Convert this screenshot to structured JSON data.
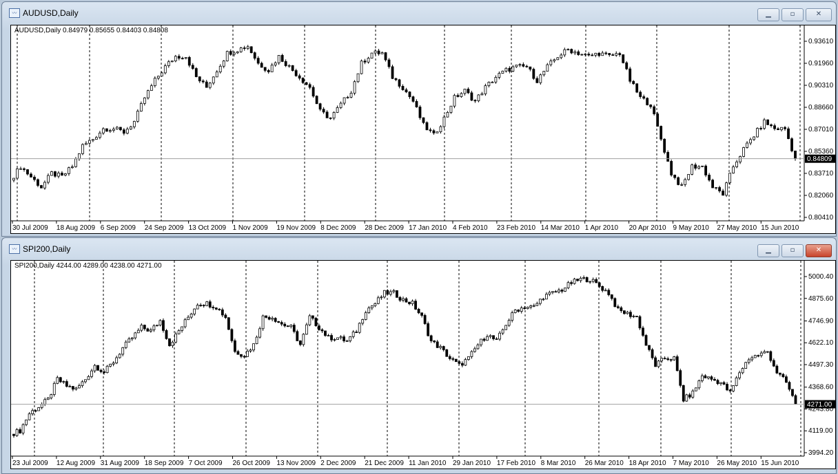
{
  "windows": [
    {
      "title": "AUDUSD,Daily",
      "info": "AUDUSD,Daily  0.84979 0.85655 0.84403 0.84808",
      "buttons": {
        "minimize": "minimize-icon",
        "maximize": "maximize-icon",
        "close": "close-icon"
      }
    },
    {
      "title": "SPI200,Daily",
      "info": "SPI200,Daily  4244.00 4289.00 4238.00 4271.00",
      "buttons": {
        "minimize": "minimize-icon",
        "maximize": "maximize-icon",
        "close": "close-icon"
      }
    }
  ],
  "chart_data": [
    {
      "type": "candlestick",
      "symbol": "AUDUSD",
      "timeframe": "Daily",
      "last_ohlc": {
        "open": 0.84979,
        "high": 0.85655,
        "low": 0.84403,
        "close": 0.84809
      },
      "current_price_label": "0.84809",
      "ylim": [
        0.8041,
        0.9361
      ],
      "y_ticks": [
        "0.93610",
        "0.91960",
        "0.90310",
        "0.88660",
        "0.87010",
        "0.85360",
        "0.83710",
        "0.82060",
        "0.80410"
      ],
      "x_ticks": [
        "30 Jul 2009",
        "18 Aug 2009",
        "6 Sep 2009",
        "24 Sep 2009",
        "13 Oct 2009",
        "1 Nov 2009",
        "19 Nov 2009",
        "8 Dec 2009",
        "28 Dec 2009",
        "17 Jan 2010",
        "4 Feb 2010",
        "23 Feb 2010",
        "14 Mar 2010",
        "1 Apr 2010",
        "20 Apr 2010",
        "9 May 2010",
        "27 May 2010",
        "15 Jun 2010"
      ],
      "closes_approx": [
        0.832,
        0.8423,
        0.8345,
        0.8268,
        0.8371,
        0.8345,
        0.8423,
        0.8577,
        0.8629,
        0.8706,
        0.8706,
        0.868,
        0.8758,
        0.8938,
        0.9067,
        0.917,
        0.9248,
        0.9248,
        0.9093,
        0.9016,
        0.9144,
        0.9273,
        0.9299,
        0.9325,
        0.9196,
        0.9144,
        0.9248,
        0.917,
        0.9093,
        0.9016,
        0.8835,
        0.8784,
        0.8887,
        0.899,
        0.9196,
        0.9273,
        0.9273,
        0.9093,
        0.9016,
        0.8912,
        0.8732,
        0.8655,
        0.8784,
        0.8938,
        0.899,
        0.8912,
        0.9016,
        0.9093,
        0.9144,
        0.917,
        0.917,
        0.9067,
        0.917,
        0.9248,
        0.9299,
        0.9273,
        0.9248,
        0.9273,
        0.9248,
        0.9273,
        0.9067,
        0.8938,
        0.8887,
        0.8629,
        0.8371,
        0.8268,
        0.8423,
        0.8423,
        0.8268,
        0.8216,
        0.8423,
        0.8552,
        0.8655,
        0.8758,
        0.8706,
        0.8706,
        0.8481
      ]
    },
    {
      "type": "candlestick",
      "symbol": "SPI200",
      "timeframe": "Daily",
      "last_ohlc": {
        "open": 4244.0,
        "high": 4289.0,
        "low": 4238.0,
        "close": 4271.0
      },
      "current_price_label": "4271.00",
      "ylim": [
        3994.2,
        5000.4
      ],
      "y_ticks": [
        "5000.40",
        "4875.60",
        "4746.90",
        "4622.10",
        "4497.30",
        "4368.60",
        "4243.80",
        "4119.00",
        "3994.20"
      ],
      "x_ticks": [
        "23 Jul 2009",
        "12 Aug 2009",
        "31 Aug 2009",
        "18 Sep 2009",
        "7 Oct 2009",
        "26 Oct 2009",
        "13 Nov 2009",
        "2 Dec 2009",
        "21 Dec 2009",
        "11 Jan 2010",
        "29 Jan 2010",
        "17 Feb 2010",
        "8 Mar 2010",
        "26 Mar 2010",
        "18 Apr 2010",
        "7 May 2010",
        "26 May 2010",
        "15 Jun 2010"
      ],
      "closes_approx": [
        4100,
        4120,
        4218,
        4257,
        4297,
        4414,
        4375,
        4356,
        4414,
        4493,
        4454,
        4513,
        4592,
        4651,
        4710,
        4690,
        4749,
        4611,
        4690,
        4769,
        4847,
        4847,
        4827,
        4769,
        4572,
        4552,
        4611,
        4769,
        4769,
        4729,
        4710,
        4611,
        4769,
        4710,
        4651,
        4651,
        4631,
        4690,
        4808,
        4847,
        4906,
        4906,
        4867,
        4847,
        4769,
        4631,
        4592,
        4533,
        4493,
        4533,
        4611,
        4670,
        4631,
        4729,
        4808,
        4827,
        4827,
        4886,
        4906,
        4926,
        4965,
        4985,
        4985,
        4945,
        4906,
        4808,
        4788,
        4769,
        4611,
        4493,
        4533,
        4533,
        4297,
        4336,
        4434,
        4414,
        4395,
        4336,
        4454,
        4533,
        4552,
        4572,
        4454,
        4395,
        4271
      ]
    }
  ]
}
